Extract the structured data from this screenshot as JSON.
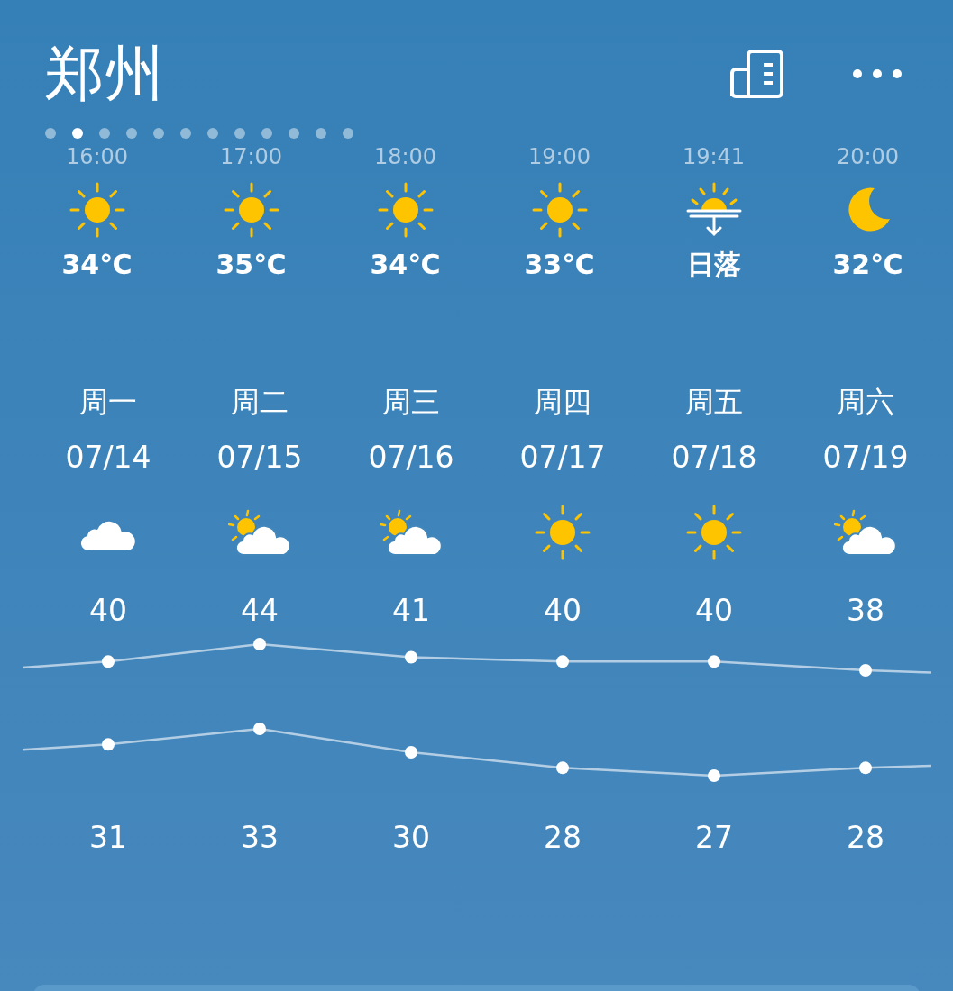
{
  "city": "郑州",
  "pages": [
    {
      "selected": false
    },
    {
      "selected": true
    },
    {
      "selected": false
    },
    {
      "selected": false
    },
    {
      "selected": false
    },
    {
      "selected": false
    },
    {
      "selected": false
    },
    {
      "selected": false
    },
    {
      "selected": false
    },
    {
      "selected": false
    },
    {
      "selected": false
    },
    {
      "selected": false
    }
  ],
  "hourly": [
    {
      "time": "16:00",
      "kind": "sun",
      "label": "34℃"
    },
    {
      "time": "17:00",
      "kind": "sun",
      "label": "35℃"
    },
    {
      "time": "18:00",
      "kind": "sun",
      "label": "34℃"
    },
    {
      "time": "19:00",
      "kind": "sun",
      "label": "33℃"
    },
    {
      "time": "19:41",
      "kind": "sunset",
      "label": "日落"
    },
    {
      "time": "20:00",
      "kind": "moon",
      "label": "32℃"
    }
  ],
  "daily": [
    {
      "weekday": "周一",
      "date": "07/14",
      "kind": "cloud",
      "high": "40",
      "low": "31"
    },
    {
      "weekday": "周二",
      "date": "07/15",
      "kind": "partly_cloudy",
      "high": "44",
      "low": "33"
    },
    {
      "weekday": "周三",
      "date": "07/16",
      "kind": "partly_cloudy",
      "high": "41",
      "low": "30"
    },
    {
      "weekday": "周四",
      "date": "07/17",
      "kind": "sun",
      "high": "40",
      "low": "28"
    },
    {
      "weekday": "周五",
      "date": "07/18",
      "kind": "sun",
      "high": "40",
      "low": "27"
    },
    {
      "weekday": "周六",
      "date": "07/19",
      "kind": "partly_cloudy",
      "high": "38",
      "low": "28"
    }
  ]
}
